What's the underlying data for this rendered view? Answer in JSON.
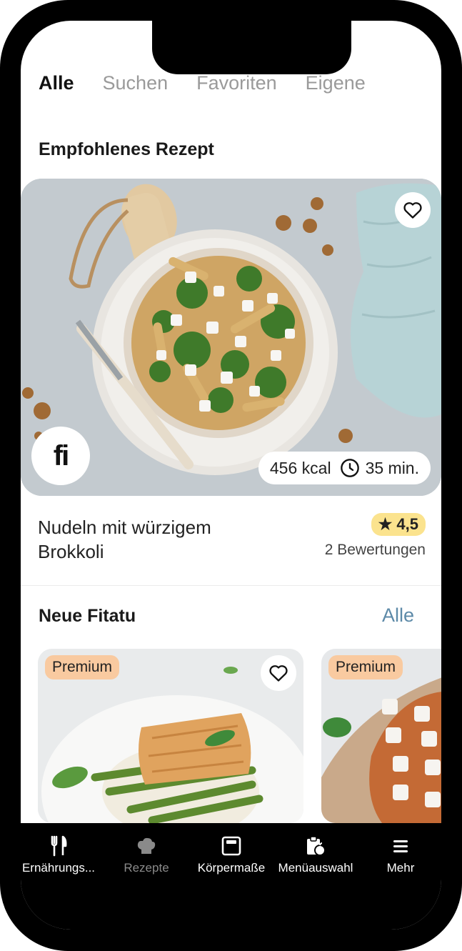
{
  "tabs": [
    {
      "label": "Alle",
      "active": true
    },
    {
      "label": "Suchen",
      "active": false
    },
    {
      "label": "Favoriten",
      "active": false
    },
    {
      "label": "Eigene",
      "active": false
    }
  ],
  "featured": {
    "section_title": "Empfohlenes Rezept",
    "recipe_title_line1": "Nudeln mit würzigem",
    "recipe_title_line2": "Brokkoli",
    "kcal": "456 kcal",
    "time": "35 min.",
    "rating": "4,5",
    "ratings_count": "2 Bewertungen",
    "brand_badge_text": "fi"
  },
  "new_section": {
    "title": "Neue Fitatu",
    "see_all": "Alle",
    "cards": [
      {
        "badge": "Premium"
      },
      {
        "badge": "Premium"
      }
    ]
  },
  "bottom_nav": [
    {
      "label": "Ernährungs...",
      "icon": "cutlery-icon",
      "active": true
    },
    {
      "label": "Rezepte",
      "icon": "chef-hat-icon",
      "active": false
    },
    {
      "label": "Körpermaße",
      "icon": "scale-icon",
      "active": true
    },
    {
      "label": "Menüauswahl",
      "icon": "clipboard-apple-icon",
      "active": true
    },
    {
      "label": "Mehr",
      "icon": "menu-icon",
      "active": true
    }
  ],
  "colors": {
    "accent_link": "#5d8aa8",
    "premium_badge": "#f9caa0",
    "rating_badge": "#fbe38e"
  }
}
